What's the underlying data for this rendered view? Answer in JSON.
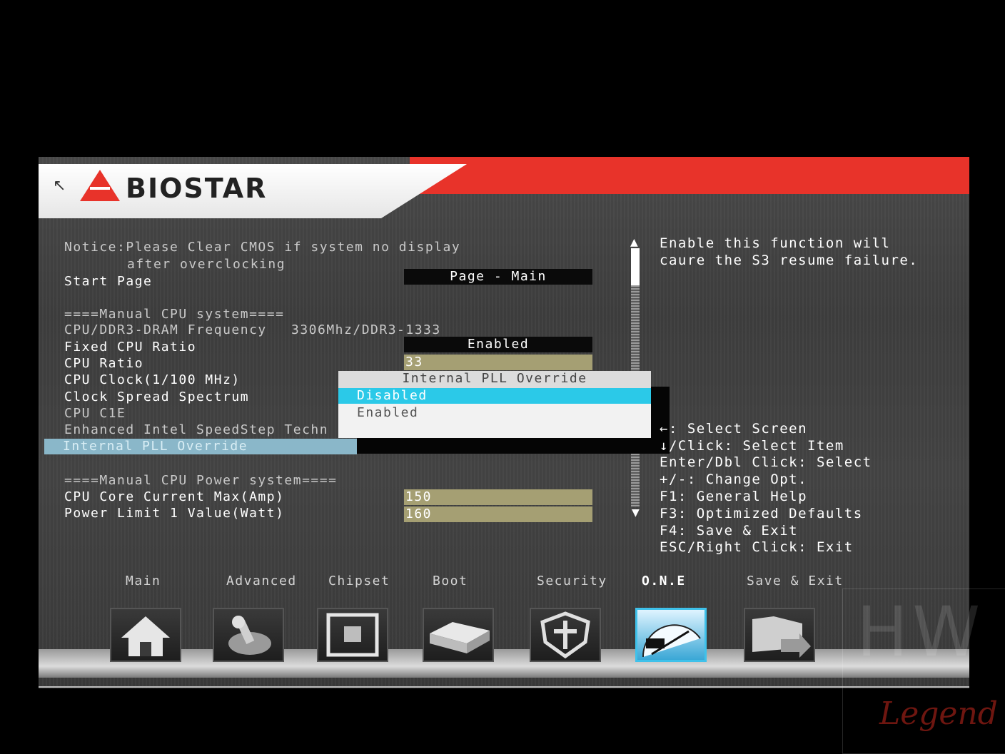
{
  "brand": {
    "name": "BIOSTAR"
  },
  "notice": {
    "line1": "Notice:Please Clear CMOS if system no display",
    "line2": "after overclocking"
  },
  "settings": [
    {
      "label": "Start Page",
      "value": "Page - Main"
    },
    {
      "label": "====Manual CPU system===="
    },
    {
      "label": "CPU/DDR3-DRAM Frequency",
      "value": "3306Mhz/DDR3-1333"
    },
    {
      "label": "Fixed CPU Ratio",
      "value": "Enabled"
    },
    {
      "label": "CPU Ratio",
      "value": "33"
    },
    {
      "label": "CPU Clock(1/100 MHz)"
    },
    {
      "label": "Clock Spread Spectrum"
    },
    {
      "label": "CPU C1E"
    },
    {
      "label": "Enhanced Intel SpeedStep Techn"
    },
    {
      "label": "Internal PLL Override"
    },
    {
      "label": "====Manual CPU Power system===="
    },
    {
      "label": "CPU Core Current Max(Amp)",
      "value": "150"
    },
    {
      "label": "Power Limit 1 Value(Watt)",
      "value": "160"
    }
  ],
  "popup": {
    "title": "Internal PLL Override",
    "options": [
      "Disabled",
      "Enabled"
    ],
    "selected": "Disabled"
  },
  "help": {
    "description": [
      "Enable this function will",
      "caure the S3 resume failure."
    ],
    "keys": [
      "←: Select Screen",
      "↓/Click: Select Item",
      "Enter/Dbl Click: Select",
      "+/-: Change Opt.",
      "F1: General Help",
      "F3: Optimized Defaults",
      "F4: Save & Exit",
      "ESC/Right Click: Exit"
    ]
  },
  "tabs": [
    {
      "label": "Main",
      "icon": "home-icon"
    },
    {
      "label": "Advanced",
      "icon": "joystick-icon"
    },
    {
      "label": "Chipset",
      "icon": "chip-icon"
    },
    {
      "label": "Boot",
      "icon": "drive-icon"
    },
    {
      "label": "Security",
      "icon": "shield-icon"
    },
    {
      "label": "O.N.E",
      "icon": "gauge-icon",
      "active": true
    },
    {
      "label": "Save & Exit",
      "icon": "folder-arrow-icon"
    }
  ],
  "watermark": {
    "top": "HW",
    "bottom": "Legend"
  },
  "colors": {
    "accent_red": "#e8332a",
    "selection_cyan": "#2bc9e8",
    "value_olive": "#a59f73"
  }
}
